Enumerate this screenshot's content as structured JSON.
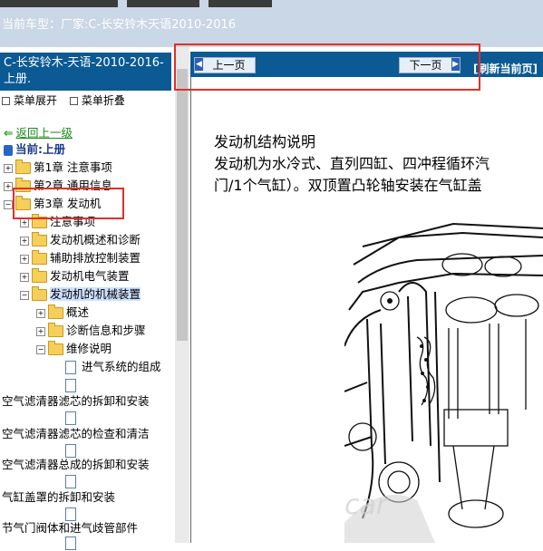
{
  "header": {
    "car_info": "当前车型：厂家:C-长安铃木天语2010-2016"
  },
  "tree": {
    "title": "C-长安铃木-天语-2010-2016- 上册.",
    "expand_label": "菜单展开",
    "collapse_label": "菜单折叠",
    "back_label": "返回上一级",
    "current_label": "当前:上册",
    "items": [
      {
        "label": "第1章 注意事项"
      },
      {
        "label": "第2章 通用信息"
      },
      {
        "label": "第3章 发动机"
      },
      {
        "label": "注意事项"
      },
      {
        "label": "发动机概述和诊断"
      },
      {
        "label": "辅助排放控制装置"
      },
      {
        "label": "发动机电气装置"
      },
      {
        "label": "发动机的机械装置"
      },
      {
        "label": "概述"
      },
      {
        "label": "诊断信息和步骤"
      },
      {
        "label": "维修说明"
      },
      {
        "label": "进气系统的组成"
      },
      {
        "label": "空气滤清器滤芯的拆卸和安装"
      },
      {
        "label": "空气滤清器滤芯的检查和清洁"
      },
      {
        "label": "空气滤清器总成的拆卸和安装"
      },
      {
        "label": "气缸盖罩的拆卸和安装"
      },
      {
        "label": "节气门阀体和进气歧管部件"
      }
    ]
  },
  "nav": {
    "prev_label": "上一页",
    "next_label": "下一页",
    "refresh_label": "[刷新当前页]"
  },
  "content": {
    "heading": "发动机结构说明",
    "line1": "发动机为水冷式、直列四缸、四冲程循环汽",
    "line2": "门/1个气缸）。双顶置凸轮轴安装在气缸盖"
  },
  "watermark": "car"
}
